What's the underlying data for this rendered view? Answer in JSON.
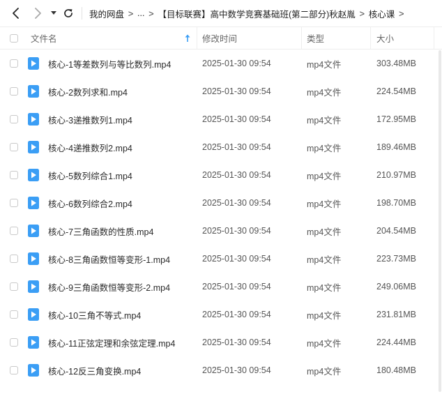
{
  "nav": {
    "back_icon": "chevron-left-icon",
    "forward_icon": "chevron-right-icon",
    "history_icon": "caret-down-icon",
    "refresh_icon": "refresh-icon"
  },
  "breadcrumb": {
    "items": [
      "我的网盘",
      "...",
      "【目标联赛】高中数学竞赛基础班(第二部分)秋赵胤",
      "核心课"
    ],
    "separator": ">"
  },
  "table": {
    "columns": {
      "name": "文件名",
      "mtime": "修改时间",
      "type": "类型",
      "size": "大小"
    },
    "sort_icon": "sort-ascending-icon",
    "rows": [
      {
        "name": "核心-1等差数列与等比数列.mp4",
        "mtime": "2025-01-30 09:54",
        "type": "mp4文件",
        "size": "303.48MB"
      },
      {
        "name": "核心-2数列求和.mp4",
        "mtime": "2025-01-30 09:54",
        "type": "mp4文件",
        "size": "224.54MB"
      },
      {
        "name": "核心-3递推数列1.mp4",
        "mtime": "2025-01-30 09:54",
        "type": "mp4文件",
        "size": "172.95MB"
      },
      {
        "name": "核心-4递推数列2.mp4",
        "mtime": "2025-01-30 09:54",
        "type": "mp4文件",
        "size": "189.46MB"
      },
      {
        "name": "核心-5数列综合1.mp4",
        "mtime": "2025-01-30 09:54",
        "type": "mp4文件",
        "size": "210.97MB"
      },
      {
        "name": "核心-6数列综合2.mp4",
        "mtime": "2025-01-30 09:54",
        "type": "mp4文件",
        "size": "198.70MB"
      },
      {
        "name": "核心-7三角函数的性质.mp4",
        "mtime": "2025-01-30 09:54",
        "type": "mp4文件",
        "size": "204.54MB"
      },
      {
        "name": "核心-8三角函数恒等变形-1.mp4",
        "mtime": "2025-01-30 09:54",
        "type": "mp4文件",
        "size": "223.73MB"
      },
      {
        "name": "核心-9三角函数恒等变形-2.mp4",
        "mtime": "2025-01-30 09:54",
        "type": "mp4文件",
        "size": "249.06MB"
      },
      {
        "name": "核心-10三角不等式.mp4",
        "mtime": "2025-01-30 09:54",
        "type": "mp4文件",
        "size": "231.81MB"
      },
      {
        "name": "核心-11正弦定理和余弦定理.mp4",
        "mtime": "2025-01-30 09:54",
        "type": "mp4文件",
        "size": "224.44MB"
      },
      {
        "name": "核心-12反三角变换.mp4",
        "mtime": "2025-01-30 09:54",
        "type": "mp4文件",
        "size": "180.48MB"
      }
    ]
  },
  "colors": {
    "video_icon": "#3b9ef5",
    "sort_icon": "#3b9ef5",
    "divider": "#eeeeee",
    "text": "#333333"
  }
}
